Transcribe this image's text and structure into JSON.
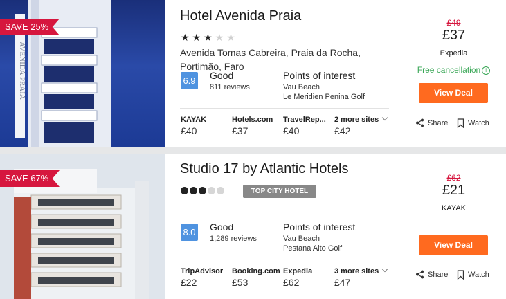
{
  "hotels": [
    {
      "save_badge": "SAVE 25%",
      "name": "Hotel Avenida Praia",
      "stars": "★★★",
      "stars_empty": "★★",
      "address_line1": "Avenida Tomas Cabreira, Praia da Rocha,",
      "address_line2": "Portimão, Faro",
      "score": "6.9",
      "rating_word": "Good",
      "reviews": "811 reviews",
      "poi_title": "Points of interest",
      "poi": [
        "Vau Beach",
        "Le Meridien Penina Golf"
      ],
      "sites": [
        {
          "name": "KAYAK",
          "price": "£40"
        },
        {
          "name": "Hotels.com",
          "price": "£37"
        },
        {
          "name": "TravelRep...",
          "price": "£40"
        }
      ],
      "more_sites": {
        "label": "2 more sites",
        "price": "£42"
      },
      "old_price": "£49",
      "price": "£37",
      "provider": "Expedia",
      "free_cancellation": "Free cancellation",
      "deal_label": "View Deal",
      "share_label": "Share",
      "watch_label": "Watch"
    },
    {
      "save_badge": "SAVE 67%",
      "name": "Studio 17 by Atlantic Hotels",
      "tag": "TOP CITY HOTEL",
      "rating_dots_filled": 3,
      "rating_dots_total": 5,
      "score": "8.0",
      "rating_word": "Good",
      "reviews": "1,289 reviews",
      "poi_title": "Points of interest",
      "poi": [
        "Vau Beach",
        "Pestana Alto Golf"
      ],
      "sites": [
        {
          "name": "TripAdvisor",
          "price": "£22"
        },
        {
          "name": "Booking.com",
          "price": "£53"
        },
        {
          "name": "Expedia",
          "price": "£62"
        }
      ],
      "more_sites": {
        "label": "3 more sites",
        "price": "£47"
      },
      "old_price": "£62",
      "price": "£21",
      "provider": "KAYAK",
      "deal_label": "View Deal",
      "share_label": "Share",
      "watch_label": "Watch"
    }
  ],
  "colors": {
    "accent": "#ff6a1f",
    "badge": "#d6163e",
    "score": "#4f93e0",
    "free": "#3aa757"
  }
}
